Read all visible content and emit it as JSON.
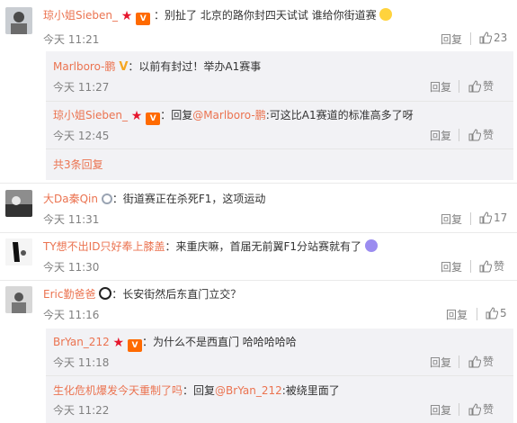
{
  "comments": [
    {
      "user": "琼小姐Sieben_",
      "text": "别扯了 北京的路你封四天试试 谁给你街道赛",
      "time": "今天 11:21",
      "reply": "回复",
      "likes": "23",
      "replies": [
        {
          "user": "Marlboro-鹏",
          "text": "以前有封过！举办A1赛事",
          "time": "今天 11:27",
          "reply": "回复",
          "like": "赞"
        },
        {
          "user": "琼小姐Sieben_",
          "text_prefix": "回复",
          "mention": "@Marlboro-鹏",
          "text": ":可这比A1赛道的标准高多了呀",
          "time": "今天 12:45",
          "reply": "回复",
          "like": "赞"
        }
      ],
      "more": "共3条回复"
    },
    {
      "user": "大Da秦Qin",
      "text": "街道赛正在杀死F1，这项运动",
      "time": "今天 11:31",
      "reply": "回复",
      "likes": "17"
    },
    {
      "user": "TY想不出ID只好奉上膝盖",
      "text": "来重庆嘛，首届无前翼F1分站赛就有了",
      "time": "今天 11:30",
      "reply": "回复",
      "like": "赞"
    },
    {
      "user": "Eric勤爸爸",
      "text": "长安街然后东直门立交？",
      "time": "今天 11:16",
      "reply": "回复",
      "likes": "5",
      "replies": [
        {
          "user": "BrYan_212",
          "text": "为什么不是西直门 哈哈哈哈哈",
          "time": "今天 11:18",
          "reply": "回复",
          "like": "赞"
        },
        {
          "user": "生化危机爆发今天重制了吗",
          "text_prefix": "回复",
          "mention": "@BrYan_212",
          "text": ":被绕里面了",
          "time": "今天 11:22",
          "reply": "回复",
          "like": "赞"
        }
      ]
    }
  ],
  "colors": {
    "username": "#eb7350",
    "meta": "#808080",
    "subbox": "#f2f2f5"
  }
}
